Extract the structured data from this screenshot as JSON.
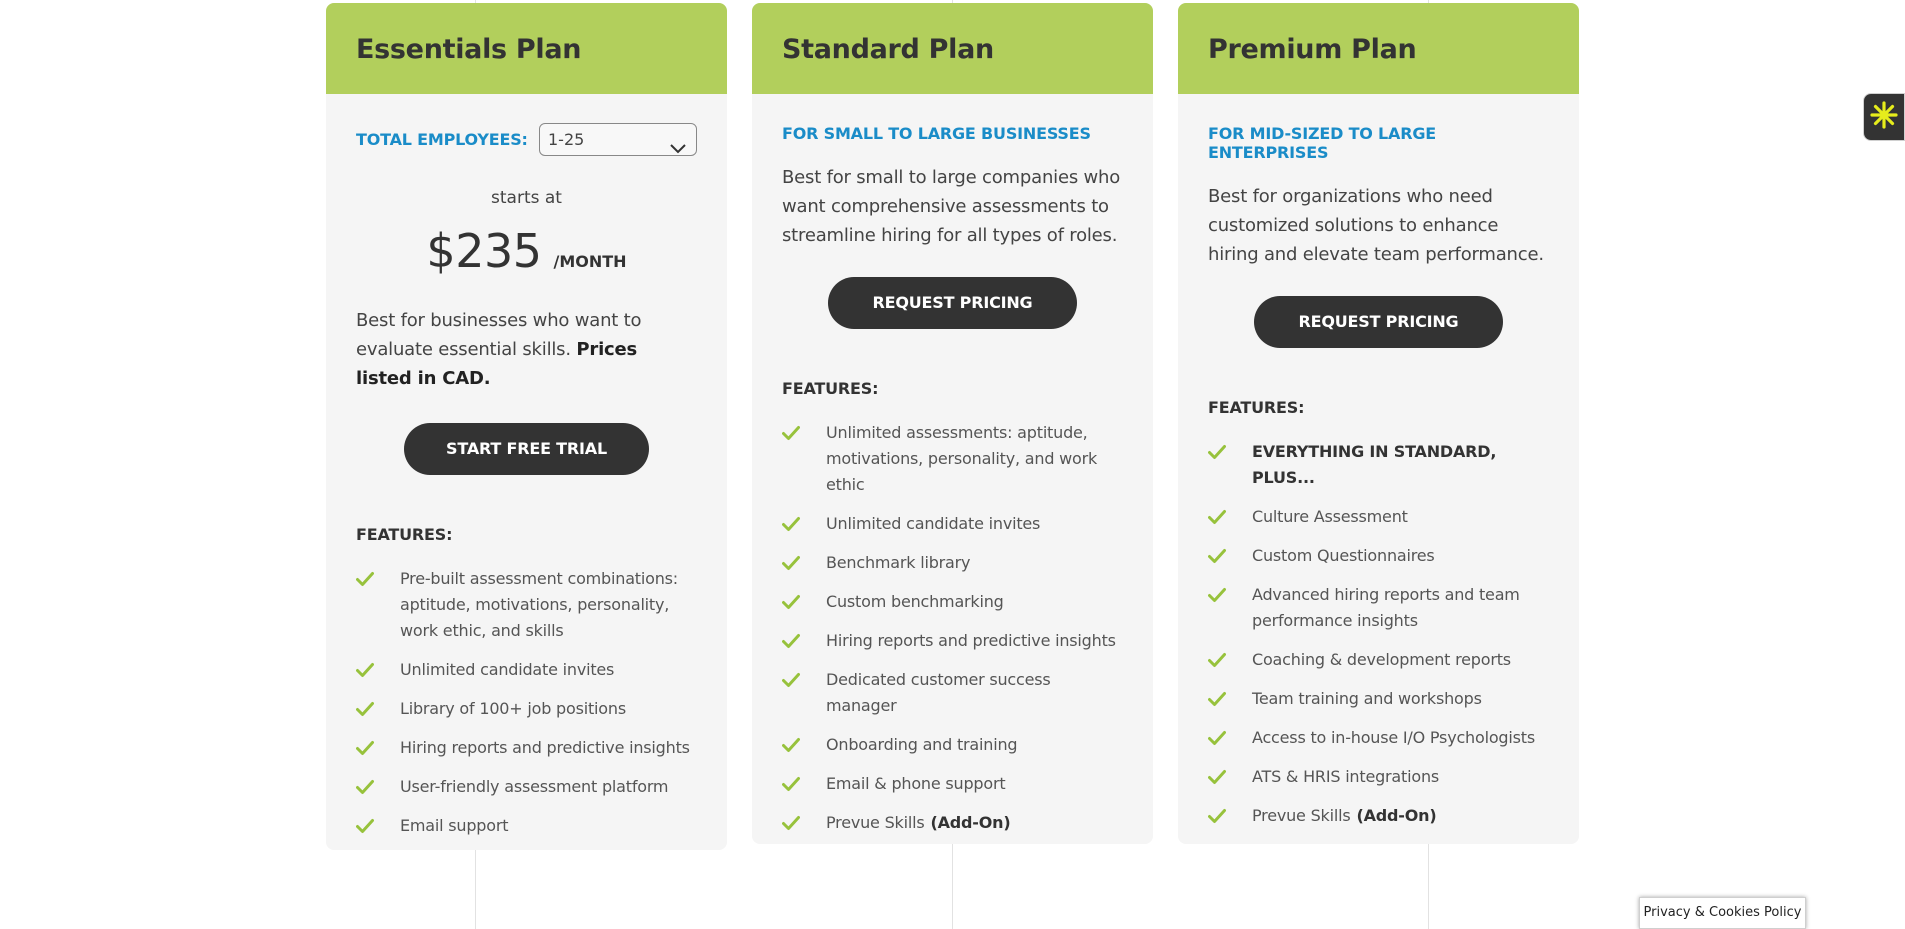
{
  "colors": {
    "header_green": "#b2cf5c",
    "accent_blue": "#1a8cc8",
    "dark_button": "#333333",
    "check_green": "#97c23c"
  },
  "plans": [
    {
      "title": "Essentials Plan",
      "employees_label": "TOTAL EMPLOYEES:",
      "employees_value": "1-25",
      "starts_at": "starts at",
      "price": "$235",
      "per": "/MONTH",
      "description": "Best for businesses who want to evaluate essential skills.",
      "description_bold": "Prices listed in CAD.",
      "button": "START FREE TRIAL",
      "features_label": "FEATURES:",
      "features": [
        "Pre-built assessment combinations: aptitude, motivations, personality, work ethic, and skills",
        "Unlimited candidate invites",
        "Library of 100+ job positions",
        "Hiring reports and predictive insights",
        "User-friendly assessment platform",
        "Email support"
      ]
    },
    {
      "title": "Standard Plan",
      "subtitle": "FOR SMALL TO LARGE BUSINESSES",
      "description": "Best for small to large companies who want comprehensive assessments to streamline hiring for all types of roles.",
      "button": "REQUEST PRICING",
      "features_label": "FEATURES:",
      "features": [
        "Unlimited assessments: aptitude, motivations, personality, and work ethic",
        "Unlimited candidate invites",
        "Benchmark library",
        "Custom benchmarking",
        "Hiring reports and predictive insights",
        "Dedicated customer success manager",
        "Onboarding and training",
        "Email & phone support",
        "Prevue Skills"
      ],
      "addon_label": "(Add-On)"
    },
    {
      "title": "Premium Plan",
      "subtitle": "FOR MID-SIZED TO LARGE ENTERPRISES",
      "description": "Best for organizations who need customized solutions to enhance hiring and elevate team performance.",
      "button": "REQUEST PRICING",
      "features_label": "FEATURES:",
      "features": [
        "EVERYTHING IN STANDARD, PLUS...",
        "Culture Assessment",
        "Custom Questionnaires",
        "Advanced hiring reports and team performance insights",
        "Coaching & development reports",
        "Team training and workshops",
        "Access to in-house I/O Psychologists",
        "ATS & HRIS integrations",
        "Prevue Skills"
      ],
      "addon_label": "(Add-On)"
    }
  ],
  "privacy_label": "Privacy & Cookies Policy",
  "widget_icon": "asterisk-icon"
}
